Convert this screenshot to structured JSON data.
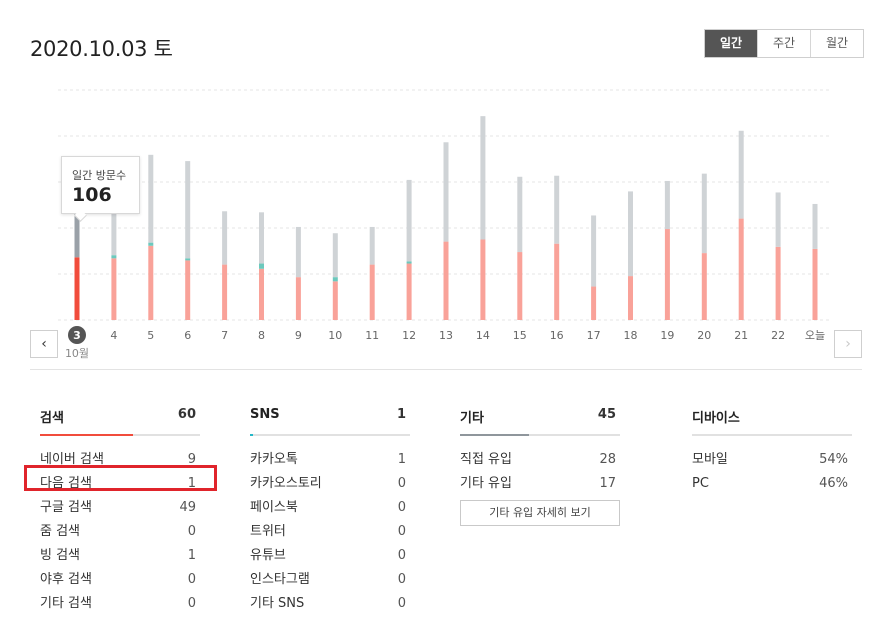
{
  "header": {
    "date": "2020.10.03 토"
  },
  "period_tabs": [
    {
      "label": "일간",
      "active": true
    },
    {
      "label": "주간",
      "active": false
    },
    {
      "label": "월간",
      "active": false
    }
  ],
  "tooltip": {
    "label": "일간 방문수",
    "value": "106"
  },
  "chart_data": {
    "type": "bar",
    "stacked": true,
    "categories": [
      "3",
      "4",
      "5",
      "6",
      "7",
      "8",
      "9",
      "10",
      "11",
      "12",
      "13",
      "14",
      "15",
      "16",
      "17",
      "18",
      "19",
      "20",
      "21",
      "22",
      "오늘"
    ],
    "selected_index": 0,
    "month_label": "10월",
    "series": [
      {
        "color": "#f9a299",
        "values": [
          60,
          59,
          71,
          57,
          53,
          49,
          41,
          37,
          53,
          54,
          75,
          77,
          65,
          73,
          32,
          42,
          87,
          64,
          97,
          70,
          68
        ]
      },
      {
        "color": "#6cc9bd",
        "values": [
          0,
          3,
          3,
          2,
          0,
          5,
          0,
          4,
          0,
          2,
          0,
          0,
          0,
          0,
          0,
          0,
          0,
          0,
          0,
          0,
          0
        ]
      },
      {
        "color": "#cfd3d6",
        "values": [
          46,
          56,
          84,
          93,
          51,
          49,
          48,
          42,
          36,
          78,
          95,
          118,
          72,
          65,
          68,
          81,
          46,
          76,
          84,
          52,
          43
        ]
      }
    ],
    "selected_colors": [
      "#f14c3c",
      "#6cc9bd",
      "#9aa1a8"
    ],
    "grid": true,
    "ymax": 220
  },
  "panels": [
    {
      "title": "검색",
      "total": "60",
      "bar_color": "#f14c3c",
      "bar_fraction": 0.58,
      "rows": [
        {
          "label": "네이버 검색",
          "value": "9"
        },
        {
          "label": "다음 검색",
          "value": "1"
        },
        {
          "label": "구글 검색",
          "value": "49"
        },
        {
          "label": "줌 검색",
          "value": "0"
        },
        {
          "label": "빙 검색",
          "value": "1"
        },
        {
          "label": "야후 검색",
          "value": "0"
        },
        {
          "label": "기타 검색",
          "value": "0"
        }
      ]
    },
    {
      "title": "SNS",
      "total": "1",
      "bar_color": "#25b8c8",
      "bar_fraction": 0.02,
      "rows": [
        {
          "label": "카카오톡",
          "value": "1"
        },
        {
          "label": "카카오스토리",
          "value": "0"
        },
        {
          "label": "페이스북",
          "value": "0"
        },
        {
          "label": "트위터",
          "value": "0"
        },
        {
          "label": "유튜브",
          "value": "0"
        },
        {
          "label": "인스타그램",
          "value": "0"
        },
        {
          "label": "기타 SNS",
          "value": "0"
        }
      ]
    },
    {
      "title": "기타",
      "total": "45",
      "bar_color": "#8f969c",
      "bar_fraction": 0.43,
      "rows": [
        {
          "label": "직접 유입",
          "value": "28"
        },
        {
          "label": "기타 유입",
          "value": "17"
        }
      ],
      "button": "기타 유입 자세히 보기"
    },
    {
      "title": "디바이스",
      "total": "",
      "bar_color": "#e1e1e1",
      "bar_fraction": 0,
      "rows": [
        {
          "label": "모바일",
          "value": "54%"
        },
        {
          "label": "PC",
          "value": "46%"
        }
      ]
    }
  ]
}
